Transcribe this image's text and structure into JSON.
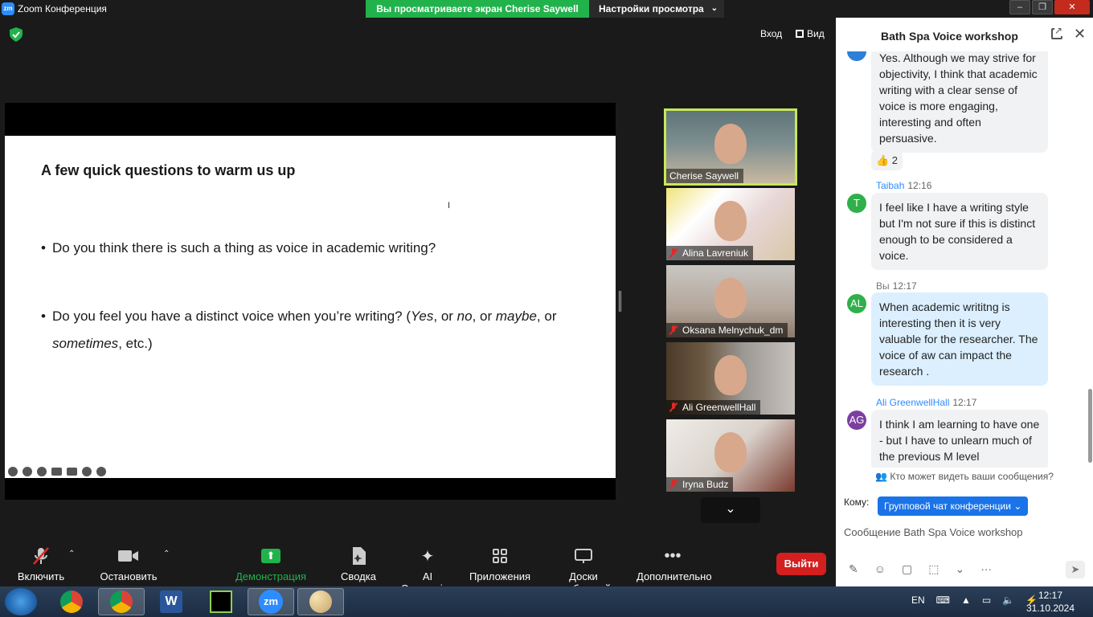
{
  "titlebar": {
    "title": "Zoom Конференция",
    "viewing_banner": "Вы просматриваете экран Cherise Saywell",
    "view_settings": "Настройки просмотра"
  },
  "meeting_top": {
    "enter": "Вход",
    "view": "Вид"
  },
  "slide": {
    "title": "A few quick questions to warm us up",
    "bullet1": "Do you think there is such a thing as voice in academic writing?",
    "bullet2_a": "Do you feel you have a distinct voice when you’re writing? (",
    "bullet2_yes": "Yes",
    "bullet2_b": ", or ",
    "bullet2_no": "no",
    "bullet2_c": ", or ",
    "bullet2_maybe": "maybe",
    "bullet2_d": ", or",
    "bullet2_sometimes": "sometimes",
    "bullet2_e": ", etc.)"
  },
  "participants": [
    {
      "name": "Cherise Saywell",
      "muted": false,
      "active_speaker": true
    },
    {
      "name": "Alina Lavreniuk",
      "muted": true
    },
    {
      "name": "Oksana Melnychuk_dm",
      "muted": true
    },
    {
      "name": "Ali GreenwellHall",
      "muted": true
    },
    {
      "name": "Iryna Budz",
      "muted": true
    }
  ],
  "toolbar": {
    "unmute": "Включить звук",
    "stop_video": "Остановить видео",
    "share_screen": "Демонстрация экрана",
    "summary": "Сводка",
    "ai_companion": "AI Companion",
    "apps": "Приложения",
    "whiteboards": "Доски сообщений",
    "more": "Дополнительно",
    "leave": "Выйти"
  },
  "chat": {
    "title": "Bath Spa Voice workshop",
    "messages": [
      {
        "text": "Yes. Although we may strive for objectivity, I think that academic writing with a clear sense of voice is more engaging, interesting and often persuasive.",
        "reaction": "👍 2"
      },
      {
        "sender": "Taibah",
        "time": "12:16",
        "initials": "T",
        "avatar_color": "#2fb04a",
        "text": "I feel like I have a writing style but I'm not sure if this is distinct enough to be considered a voice."
      },
      {
        "sender": "Вы",
        "time": "12:17",
        "initials": "AL",
        "avatar_color": "#2fb04a",
        "text": "When academic writitng is interesting then it is very valuable for the researcher. The voice of aw can impact the research ."
      },
      {
        "sender": "Ali GreenwellHall",
        "time": "12:17",
        "initials": "AG",
        "avatar_color": "#7b3fa0",
        "text": "I think I am learning to have one - but I have to unlearn much of the previous M level"
      }
    ],
    "who_sees": "Кто может видеть ваши сообщения?",
    "to_label": "Кому:",
    "to_value": "Групповой чат конференции",
    "input_placeholder": "Сообщение Bath Spa Voice workshop"
  },
  "taskbar": {
    "lang": "EN",
    "time": "12:17",
    "date": "31.10.2024"
  }
}
